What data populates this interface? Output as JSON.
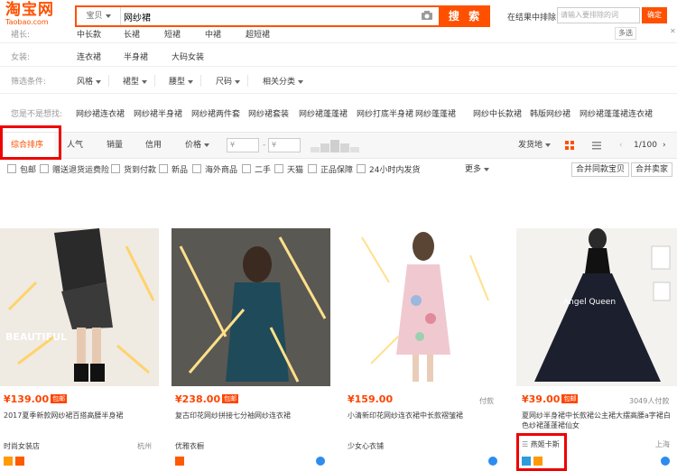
{
  "logo": {
    "cn": "淘宝网",
    "en": "Taobao.com"
  },
  "search": {
    "scope": "宝贝",
    "query": "网纱裙",
    "button": "搜 索"
  },
  "in_results": {
    "label": "在结果中排除",
    "placeholder": "请输入要排除的词",
    "confirm": "确定"
  },
  "filters": {
    "top_row": {
      "label": "裙长:",
      "options": [
        "中长款",
        "长裙",
        "短裙",
        "中裙",
        "超短裙"
      ],
      "more": "多选"
    },
    "women": {
      "label": "女装:",
      "options": [
        "连衣裙",
        "半身裙",
        "大码女装"
      ]
    },
    "criteria": {
      "label": "筛选条件:",
      "options": [
        "风格",
        "裙型",
        "腰型",
        "尺码",
        "相关分类"
      ]
    },
    "suggest": {
      "label": "您是不是想找:",
      "options": [
        "网纱裙连衣裙",
        "网纱裙半身裙",
        "网纱裙两件套",
        "网纱裙套装",
        "网纱裙蓬蓬裙",
        "网纱打底半身裙",
        "网纱蓬蓬裙",
        "网纱中长款裙",
        "韩版网纱裙",
        "网纱裙蓬蓬裙连衣裙"
      ]
    }
  },
  "sort": {
    "active": "综合排序",
    "popularity": "人气",
    "sales": "销量",
    "credit": "信用",
    "price": "价格",
    "price_min": "¥",
    "dash": "-",
    "price_max": "¥",
    "ship_from": "发货地",
    "page": "1/100"
  },
  "checkboxes": [
    "包邮",
    "赠送退货运费险",
    "货到付款",
    "新品",
    "海外商品",
    "二手",
    "天猫",
    "正品保障",
    "24小时内发货"
  ],
  "more_label": "更多",
  "merge_buttons": [
    "合并同款宝贝",
    "合并卖家"
  ],
  "products": [
    {
      "price": "¥139.00",
      "tag": "包邮",
      "pay": "",
      "title": "2017夏季新款网纱裙百搭高腰半身裙",
      "shop": "时尚女装店",
      "loc": "杭州",
      "img_text": "BEAUTIFUL"
    },
    {
      "price": "¥238.00",
      "tag": "包邮",
      "pay": "",
      "title": "复古印花网纱拼接七分袖网纱连衣裙",
      "shop": "优雅衣橱",
      "loc": "",
      "img_text": ""
    },
    {
      "price": "¥159.00",
      "tag": "",
      "pay": "付款",
      "title": "小清新印花网纱连衣裙中长款褶皱裙",
      "shop": "少女心衣铺",
      "loc": "",
      "img_text": ""
    },
    {
      "price": "¥39.00",
      "tag": "包邮",
      "pay": "3049人付款",
      "title": "夏网纱半身裙中长款裙公主裙大摆高腰a字裙白色纱裙蓬蓬裙仙女",
      "shop": "燕姬卡斯",
      "loc": "上海",
      "img_text": "Angel Queen"
    }
  ],
  "colors": {
    "accent": "#ff5000",
    "price": "#ff4400",
    "highlight": "#e00000"
  }
}
